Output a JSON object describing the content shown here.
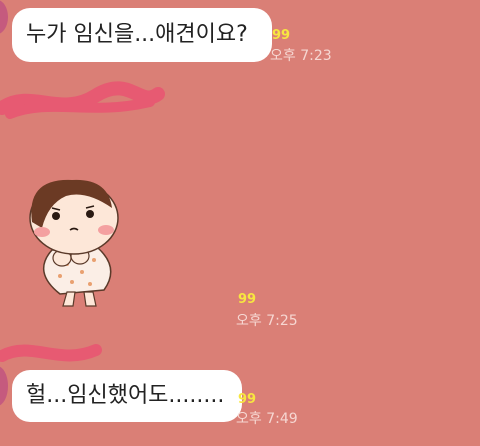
{
  "colors": {
    "background": "#da7f76",
    "bubble": "#ffffff",
    "unread": "#f7e640",
    "time": "#f6d7d2",
    "scribble": "#e75a72"
  },
  "messages": [
    {
      "text": "누가  임신을...애견이요?",
      "unread": "99",
      "time": "오후 7:23"
    },
    {
      "type": "sticker",
      "unread": "99",
      "time": "오후 7:25"
    },
    {
      "text": "헐...임신했어도........",
      "unread": "99",
      "time": "오후 7:49"
    }
  ]
}
